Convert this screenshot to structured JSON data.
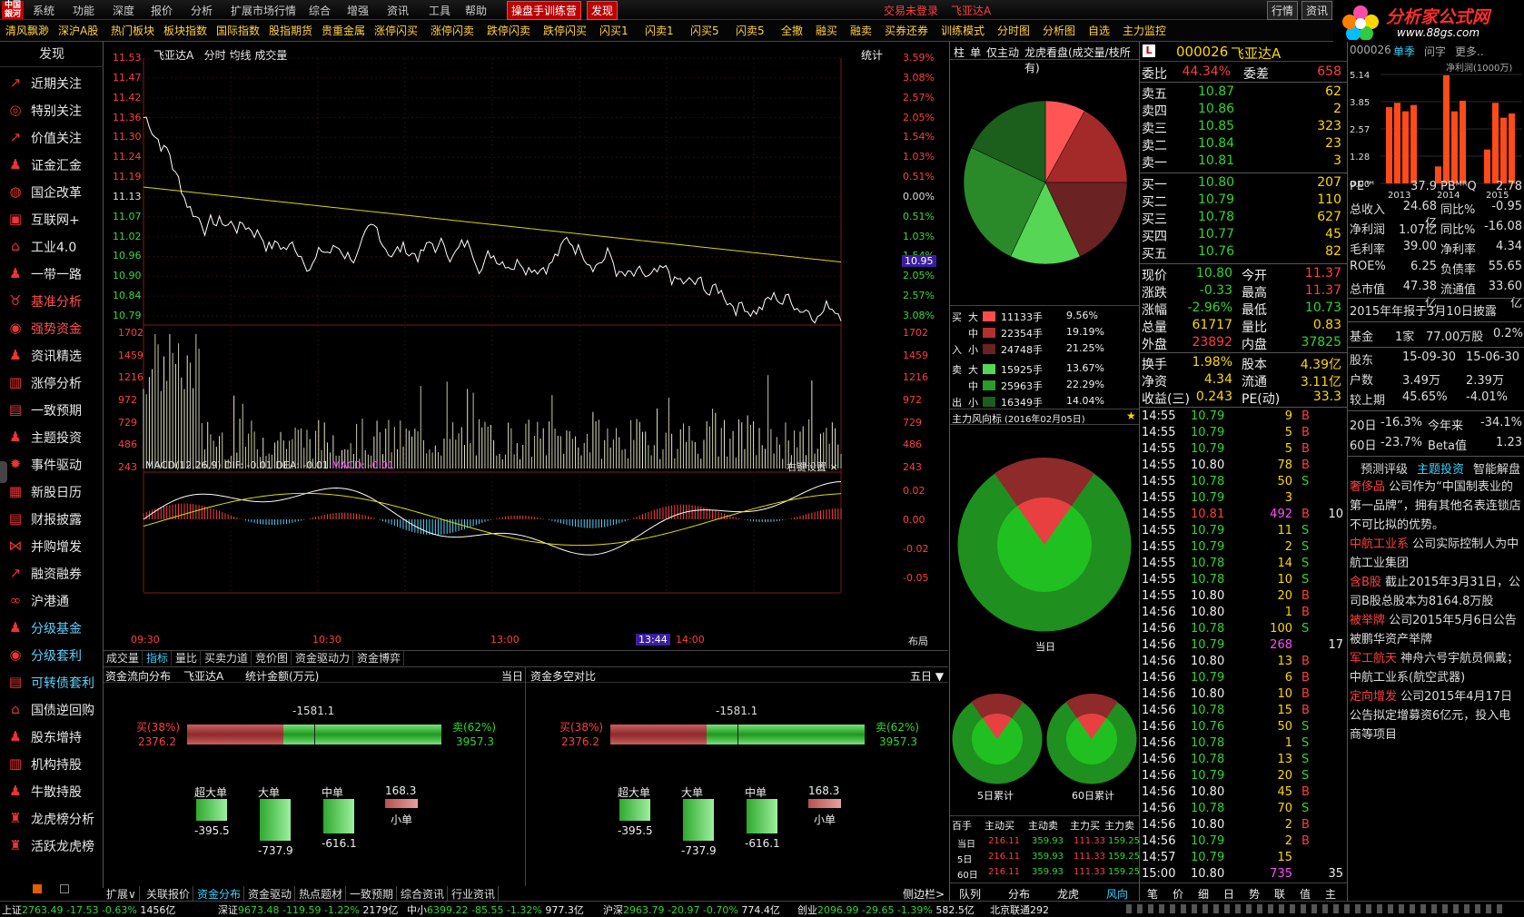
{
  "menubar": {
    "items": [
      "系统",
      "功能",
      "深度",
      "报价",
      "分析",
      "扩展市场行情",
      "综合",
      "增强",
      "资讯",
      "工具",
      "帮助"
    ],
    "highlight1": "操盘手训练营",
    "highlight2": "发现",
    "login": "交易未登录",
    "stock": "飞亚达A",
    "right": [
      "行情",
      "资讯"
    ]
  },
  "toolbar": {
    "items": [
      "清风飘渺",
      "深沪A股",
      "热门板块",
      "板块指数",
      "国际指数",
      "股指期货",
      "贵重金属",
      "涨停闪买",
      "涨停闪卖",
      "跌停闪卖",
      "跌停闪买",
      "闪买1",
      "闪卖1",
      "闪买5",
      "闪卖5",
      "全撤",
      "融买",
      "融卖",
      "买券还券",
      "训练模式",
      "分时图",
      "分析图",
      "自选",
      "主力监控"
    ]
  },
  "brand": {
    "title": "分析家公式网",
    "url": "www.88gs.com"
  },
  "sidebar": {
    "header": "发现",
    "items": [
      {
        "label": "近期关注",
        "icon": "trend-icon"
      },
      {
        "label": "特别关注",
        "icon": "target-icon"
      },
      {
        "label": "价值关注",
        "icon": "trend-icon"
      },
      {
        "label": "证金汇金",
        "icon": "person-icon"
      },
      {
        "label": "国企改革",
        "icon": "globe-icon"
      },
      {
        "label": "互联网+",
        "icon": "network-icon"
      },
      {
        "label": "工业4.0",
        "icon": "factory-icon"
      },
      {
        "label": "一带一路",
        "icon": "person-icon"
      },
      {
        "label": "基准分析",
        "icon": "pig-icon"
      },
      {
        "label": "强势资金",
        "icon": "coin-icon"
      },
      {
        "label": "资讯精选",
        "icon": "person-icon"
      },
      {
        "label": "涨停分析",
        "icon": "chart-icon"
      },
      {
        "label": "一致预期",
        "icon": "doc-icon"
      },
      {
        "label": "主题投资",
        "icon": "person-icon"
      },
      {
        "label": "事件驱动",
        "icon": "bolt-icon"
      },
      {
        "label": "新股日历",
        "icon": "calendar-icon"
      },
      {
        "label": "财报披露",
        "icon": "doc-icon"
      },
      {
        "label": "并购增发",
        "icon": "merge-icon"
      },
      {
        "label": "融资融券",
        "icon": "trend-icon"
      },
      {
        "label": "沪港通",
        "icon": "link-icon"
      },
      {
        "label": "分级基金",
        "icon": "person-icon"
      },
      {
        "label": "分级套利",
        "icon": "coin-icon"
      },
      {
        "label": "可转债套利",
        "icon": "doc-icon"
      },
      {
        "label": "国债逆回购",
        "icon": "bank-icon"
      },
      {
        "label": "股东增持",
        "icon": "person-icon"
      },
      {
        "label": "机构持股",
        "icon": "building-icon"
      },
      {
        "label": "牛散持股",
        "icon": "person-icon"
      },
      {
        "label": "龙虎榜分析",
        "icon": "dragon-icon"
      },
      {
        "label": "活跃龙虎榜",
        "icon": "dragon-icon"
      }
    ]
  },
  "chart": {
    "title": "飞亚达A",
    "mode": "分时",
    "ma": "均线",
    "vol": "成交量",
    "stat": "统计",
    "price_ticks": [
      "11.53",
      "11.47",
      "11.42",
      "11.36",
      "11.30",
      "11.24",
      "11.19",
      "11.13",
      "11.07",
      "11.02",
      "10.96",
      "10.90",
      "10.84",
      "10.79"
    ],
    "pct_ticks": [
      "3.59%",
      "3.08%",
      "2.57%",
      "2.05%",
      "1.54%",
      "1.03%",
      "0.51%",
      "0.00%",
      "0.51%",
      "1.03%",
      "1.54%",
      "2.05%",
      "2.57%",
      "3.08%"
    ],
    "cur_price": "10.95",
    "vol_ticks": [
      "1702",
      "1459",
      "1216",
      "972",
      "729",
      "486",
      "243"
    ],
    "macd_title": "MACD(12,26,9)",
    "dif": "DIF: -0.01",
    "dea": "DEA: -0.01",
    "macd": "MACD: -0.01",
    "macd_right": "右键设置",
    "macd_ticks": [
      "0.02",
      "0.00",
      "-0.02",
      "-0.05"
    ],
    "time_ticks": [
      "09:30",
      "10:30",
      "13:00",
      "14:00"
    ],
    "time_hl": "13:44",
    "layout": "布局",
    "tabs": [
      "成交量",
      "指标",
      "量比",
      "买卖力道",
      "竞价图",
      "资金驱动力",
      "资金博弈"
    ]
  },
  "fund": {
    "left_title": "资金流向分布",
    "stock": "飞亚达A",
    "unit": "统计金额(万元)",
    "today": "当日",
    "right_title": "资金多空对比",
    "period": "五日",
    "net": "-1581.1",
    "buy_label": "买(38%)",
    "buy_val": "2376.2",
    "sell_label": "卖(62%)",
    "sell_val": "3957.3",
    "buy_pct": 38,
    "bars": [
      {
        "name": "超大单",
        "val": "-395.5"
      },
      {
        "name": "大单",
        "val": "-737.9"
      },
      {
        "name": "中单",
        "val": "-616.1"
      },
      {
        "name": "小单",
        "val": "168.3"
      }
    ]
  },
  "bottomtabs": [
    "扩展∨",
    "关联报价",
    "资金分布",
    "资金驱动",
    "热点题材",
    "一致预期",
    "综合资讯",
    "行业资讯"
  ],
  "sidebar_toggle": "侧边栏>",
  "mid": {
    "tabs": [
      "柱",
      "单",
      "仅主动",
      "龙虎看盘(成交量/枝所有)"
    ],
    "pie_pct": [
      8,
      17,
      18,
      14,
      25,
      18
    ],
    "flow": [
      {
        "side": "买",
        "size": "大",
        "hands": "11133手",
        "pct": "9.56%",
        "color": "#ff4d4d"
      },
      {
        "side": "",
        "size": "中",
        "hands": "22354手",
        "pct": "19.19%",
        "color": "#b43030"
      },
      {
        "side": "入",
        "size": "小",
        "hands": "24748手",
        "pct": "21.25%",
        "color": "#6b2222"
      },
      {
        "side": "卖",
        "size": "大",
        "hands": "15925手",
        "pct": "13.67%",
        "color": "#55d655"
      },
      {
        "side": "",
        "size": "中",
        "hands": "25963手",
        "pct": "22.29%",
        "color": "#2a9a2a"
      },
      {
        "side": "出",
        "size": "小",
        "hands": "16349手",
        "pct": "14.04%",
        "color": "#1c5e1c"
      }
    ],
    "wind_title": "主力风向标",
    "wind_date": "(2016年02月05日)",
    "today": "当日",
    "d5": "5日累计",
    "d60": "60日累计",
    "table_head": [
      "百手",
      "主动买",
      "主动卖",
      "主力买",
      "主力卖"
    ],
    "table": [
      [
        "当日",
        "216.11",
        "359.93",
        "111.33",
        "159.25"
      ],
      [
        "5日",
        "216.11",
        "359.93",
        "111.33",
        "159.25"
      ],
      [
        "60日",
        "216.11",
        "359.93",
        "111.33",
        "159.25"
      ]
    ],
    "bottom": [
      "队列",
      "分布",
      "龙虎",
      "风向"
    ]
  },
  "quote": {
    "code": "000026",
    "name": "飞亚达A",
    "wb_label": "委比",
    "wb": "44.34%",
    "wc_label": "委差",
    "wc": "658",
    "sells": [
      [
        "卖五",
        "10.87",
        "62"
      ],
      [
        "卖四",
        "10.86",
        "2"
      ],
      [
        "卖三",
        "10.85",
        "323"
      ],
      [
        "卖二",
        "10.84",
        "23"
      ],
      [
        "卖一",
        "10.81",
        "3"
      ]
    ],
    "buys": [
      [
        "买一",
        "10.80",
        "207"
      ],
      [
        "买二",
        "10.79",
        "110"
      ],
      [
        "买三",
        "10.78",
        "627"
      ],
      [
        "买四",
        "10.77",
        "45"
      ],
      [
        "买五",
        "10.76",
        "82"
      ]
    ],
    "stats": [
      [
        "现价",
        "10.80",
        "今开",
        "11.37"
      ],
      [
        "涨跌",
        "-0.33",
        "最高",
        "11.37"
      ],
      [
        "涨幅",
        "-2.96%",
        "最低",
        "10.73"
      ],
      [
        "总量",
        "61717",
        "量比",
        "0.83"
      ],
      [
        "外盘",
        "23892",
        "内盘",
        "37825"
      ]
    ],
    "stats2": [
      [
        "换手",
        "1.98%",
        "股本",
        "4.39亿"
      ],
      [
        "净资",
        "4.34",
        "流通",
        "3.11亿"
      ],
      [
        "收益(三)",
        "0.243",
        "PE(动)",
        "33.3"
      ]
    ],
    "ticks": [
      [
        "14:55",
        "10.79",
        "9",
        "B"
      ],
      [
        "14:55",
        "10.79",
        "5",
        "B"
      ],
      [
        "14:55",
        "10.79",
        "5",
        "B"
      ],
      [
        "14:55",
        "10.80",
        "78",
        "B"
      ],
      [
        "14:55",
        "10.78",
        "50",
        "S"
      ],
      [
        "14:55",
        "10.79",
        "3",
        ""
      ],
      [
        "14:55",
        "10.81",
        "492",
        "B"
      ],
      [
        "14:55",
        "10.79",
        "11",
        "S"
      ],
      [
        "14:55",
        "10.79",
        "2",
        "S"
      ],
      [
        "14:55",
        "10.78",
        "14",
        "S"
      ],
      [
        "14:55",
        "10.78",
        "10",
        "S"
      ],
      [
        "14:55",
        "10.80",
        "20",
        "B"
      ],
      [
        "14:56",
        "10.80",
        "1",
        "B"
      ],
      [
        "14:56",
        "10.78",
        "100",
        "S"
      ],
      [
        "14:56",
        "10.79",
        "268",
        ""
      ],
      [
        "14:56",
        "10.80",
        "13",
        "B"
      ],
      [
        "14:56",
        "10.79",
        "6",
        "B"
      ],
      [
        "14:56",
        "10.80",
        "10",
        "B"
      ],
      [
        "14:56",
        "10.78",
        "15",
        "B"
      ],
      [
        "14:56",
        "10.76",
        "50",
        "S"
      ],
      [
        "14:56",
        "10.78",
        "1",
        "S"
      ],
      [
        "14:56",
        "10.78",
        "13",
        "S"
      ],
      [
        "14:56",
        "10.79",
        "20",
        "S"
      ],
      [
        "14:56",
        "10.80",
        "45",
        "B"
      ],
      [
        "14:56",
        "10.78",
        "70",
        "S"
      ],
      [
        "14:56",
        "10.80",
        "2",
        "B"
      ],
      [
        "14:56",
        "10.79",
        "2",
        "B"
      ],
      [
        "14:57",
        "10.79",
        "15",
        ""
      ],
      [
        "15:00",
        "10.80",
        "735",
        ""
      ]
    ],
    "tick_extra": [
      "",
      "",
      "",
      "",
      "",
      "",
      "10",
      "",
      "",
      "",
      "",
      "",
      "",
      "",
      "17",
      "",
      "",
      "",
      "",
      "",
      "",
      "",
      "",
      "",
      "",
      "",
      "",
      "",
      "35"
    ],
    "bottom": [
      "笔",
      "价",
      "细",
      "日",
      "势",
      "联",
      "值",
      "主"
    ]
  },
  "f10": {
    "code": "000026",
    "tabs": [
      "单季",
      "问字",
      "更多.."
    ],
    "chart_label": "净利润(1000万)",
    "y": [
      "5.14",
      "3.85",
      "2.57",
      "1.28",
      "0.00"
    ],
    "x": [
      "2013",
      "2014",
      "2015"
    ],
    "bars": [
      3.6,
      3.8,
      3.4,
      3.7,
      0.8,
      5.1,
      3.4,
      3.9,
      1.6,
      3.8,
      3.1,
      3.3
    ],
    "rows": [
      [
        "PE™",
        "37.9",
        "PBᴹᴿQ",
        "2.78"
      ],
      [
        "总收入",
        "24.68亿",
        "同比%",
        "-0.95"
      ],
      [
        "净利润",
        "1.07亿",
        "同比%",
        "-16.08"
      ],
      [
        "毛利率",
        "39.00",
        "净利率",
        "4.34"
      ],
      [
        "ROE%",
        "6.25",
        "负债率",
        "55.65"
      ],
      [
        "总市值",
        "47.38亿",
        "流通值",
        "33.60亿"
      ]
    ],
    "report": "2015年年报于3月10日披露",
    "fund": [
      "基金",
      "1家",
      "77.00万股",
      "0.2%"
    ],
    "holders": [
      [
        "股东",
        "15-09-30",
        "15-06-30"
      ],
      [
        "户数",
        "3.49万",
        "2.39万"
      ],
      [
        "较上期",
        "45.65%",
        "-4.01%"
      ]
    ],
    "perf": [
      [
        "20日",
        "-16.3%",
        "今年来",
        "-34.1%"
      ],
      [
        "60日",
        "-23.7%",
        "Beta值",
        "1.23"
      ]
    ],
    "sub_tabs": [
      "预测评级",
      "主题投资",
      "智能解盘"
    ],
    "themes": [
      {
        "t": "奢侈品",
        "d": "公司作为“中国制表业的第一品牌”，拥有其他名表连锁店不可比拟的优势。"
      },
      {
        "t": "中航工业系",
        "d": "公司实际控制人为中航工业集团"
      },
      {
        "t": "含B股",
        "d": "截止2015年3月31日，公司B股总股本为8164.8万股"
      },
      {
        "t": "被举牌",
        "d": "公司2015年5月6日公告被鹏华资产举牌"
      },
      {
        "t": "军工航天",
        "d": "神舟六号宇航员佩戴；中航工业系(航空武器)"
      },
      {
        "t": "定向增发",
        "d": "公司2015年4月17日公告拟定增募资6亿元，投入电商等项目"
      }
    ]
  },
  "status": [
    [
      "上证",
      "2763.49",
      "-17.53",
      "-0.63%",
      "1456亿"
    ],
    [
      "深证",
      "9673.48",
      "-119.59",
      "-1.22%",
      "2179亿"
    ],
    [
      "中小",
      "6399.22",
      "-85.55",
      "-1.32%",
      "977.3亿"
    ],
    [
      "沪深",
      "2963.79",
      "-20.97",
      "-0.70%",
      "774.4亿"
    ],
    [
      "创业",
      "2096.99",
      "-29.65",
      "-1.39%",
      "582.5亿"
    ]
  ],
  "status_tail": "北京联通292"
}
